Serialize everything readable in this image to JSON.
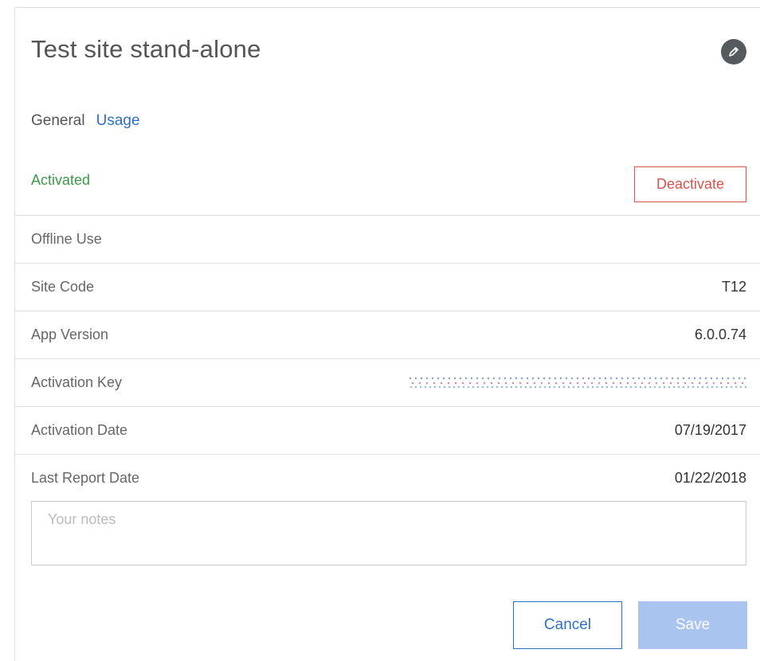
{
  "header": {
    "title": "Test site stand-alone",
    "edit_icon": "pencil-icon"
  },
  "tabs": [
    {
      "label": "General",
      "active": true
    },
    {
      "label": "Usage",
      "active": false
    }
  ],
  "status": {
    "text": "Activated",
    "color": "#3a9a48",
    "deactivate_label": "Deactivate"
  },
  "details": [
    {
      "label": "Offline Use",
      "value": ""
    },
    {
      "label": "Site Code",
      "value": "T12"
    },
    {
      "label": "App Version",
      "value": "6.0.0.74"
    },
    {
      "label": "Activation Key",
      "value": ""
    },
    {
      "label": "Activation Date",
      "value": "07/19/2017"
    },
    {
      "label": "Last Report Date",
      "value": "01/22/2018"
    }
  ],
  "notes": {
    "value": "",
    "placeholder": "Your notes"
  },
  "footer": {
    "cancel_label": "Cancel",
    "save_label": "Save"
  },
  "colors": {
    "accent": "#2f6fc4",
    "danger": "#d9534f",
    "save_disabled": "#a8c4ef"
  }
}
